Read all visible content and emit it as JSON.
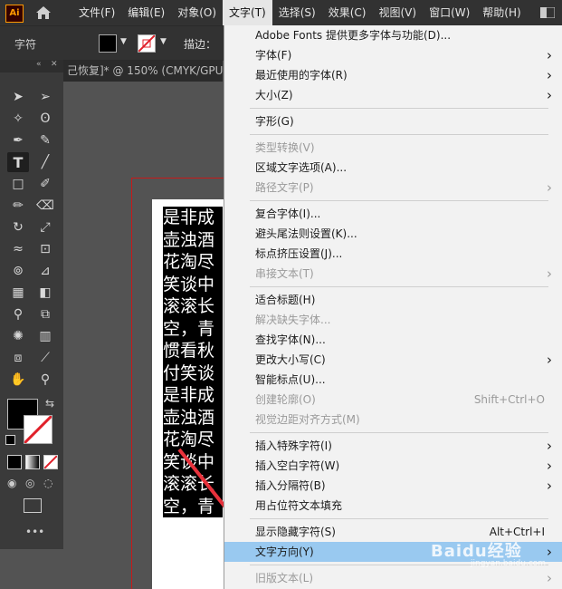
{
  "app": {
    "logo": "Ai"
  },
  "menubar": {
    "items": [
      "文件(F)",
      "编辑(E)",
      "对象(O)",
      "文字(T)",
      "选择(S)",
      "效果(C)",
      "视图(V)",
      "窗口(W)",
      "帮助(H)"
    ],
    "active_index": 3
  },
  "control_bar": {
    "label": "字符",
    "stroke_label": "描边："
  },
  "document": {
    "tab_title": "己恢复]* @ 150% (CMYK/GPU"
  },
  "artwork_lines": [
    "是非成",
    "壶浊酒",
    "花淘尽",
    "笑谈中",
    "滚滚长",
    "空，青",
    "惯看秋",
    "付笑谈",
    "是非成",
    "壶浊酒",
    "花淘尽",
    "笑谈中",
    "滚滚长",
    "空，青"
  ],
  "type_menu": {
    "groups": [
      [
        {
          "label": "Adobe Fonts 提供更多字体与功能(D)...",
          "shortcut": "",
          "submenu": false,
          "disabled": false
        },
        {
          "label": "字体(F)",
          "shortcut": "",
          "submenu": true,
          "disabled": false
        },
        {
          "label": "最近使用的字体(R)",
          "shortcut": "",
          "submenu": true,
          "disabled": false
        },
        {
          "label": "大小(Z)",
          "shortcut": "",
          "submenu": true,
          "disabled": false
        }
      ],
      [
        {
          "label": "字形(G)",
          "shortcut": "",
          "submenu": false,
          "disabled": false
        }
      ],
      [
        {
          "label": "类型转换(V)",
          "shortcut": "",
          "submenu": false,
          "disabled": true
        },
        {
          "label": "区域文字选项(A)...",
          "shortcut": "",
          "submenu": false,
          "disabled": false
        },
        {
          "label": "路径文字(P)",
          "shortcut": "",
          "submenu": true,
          "disabled": true
        }
      ],
      [
        {
          "label": "复合字体(I)...",
          "shortcut": "",
          "submenu": false,
          "disabled": false
        },
        {
          "label": "避头尾法则设置(K)...",
          "shortcut": "",
          "submenu": false,
          "disabled": false
        },
        {
          "label": "标点挤压设置(J)...",
          "shortcut": "",
          "submenu": false,
          "disabled": false
        },
        {
          "label": "串接文本(T)",
          "shortcut": "",
          "submenu": true,
          "disabled": true
        }
      ],
      [
        {
          "label": "适合标题(H)",
          "shortcut": "",
          "submenu": false,
          "disabled": false
        },
        {
          "label": "解决缺失字体...",
          "shortcut": "",
          "submenu": false,
          "disabled": true
        },
        {
          "label": "查找字体(N)...",
          "shortcut": "",
          "submenu": false,
          "disabled": false
        },
        {
          "label": "更改大小写(C)",
          "shortcut": "",
          "submenu": true,
          "disabled": false
        },
        {
          "label": "智能标点(U)...",
          "shortcut": "",
          "submenu": false,
          "disabled": false
        },
        {
          "label": "创建轮廓(O)",
          "shortcut": "Shift+Ctrl+O",
          "submenu": false,
          "disabled": true
        },
        {
          "label": "视觉边距对齐方式(M)",
          "shortcut": "",
          "submenu": false,
          "disabled": true
        }
      ],
      [
        {
          "label": "插入特殊字符(I)",
          "shortcut": "",
          "submenu": true,
          "disabled": false
        },
        {
          "label": "插入空白字符(W)",
          "shortcut": "",
          "submenu": true,
          "disabled": false
        },
        {
          "label": "插入分隔符(B)",
          "shortcut": "",
          "submenu": true,
          "disabled": false
        },
        {
          "label": "用占位符文本填充",
          "shortcut": "",
          "submenu": false,
          "disabled": false
        }
      ],
      [
        {
          "label": "显示隐藏字符(S)",
          "shortcut": "Alt+Ctrl+I",
          "submenu": false,
          "disabled": false
        },
        {
          "label": "文字方向(Y)",
          "shortcut": "",
          "submenu": true,
          "disabled": false,
          "highlighted": true
        }
      ],
      [
        {
          "label": "旧版文本(L)",
          "shortcut": "",
          "submenu": true,
          "disabled": true
        }
      ]
    ]
  },
  "watermark": {
    "text": "Baidu经验",
    "sub": "jingyan.baidu.com"
  },
  "colors": {
    "menu_bg": "#323232",
    "dropdown_bg": "#f2f2f2",
    "highlight": "#99c9f0",
    "arrow": "#e8323c",
    "accent": "#ff9a00"
  }
}
